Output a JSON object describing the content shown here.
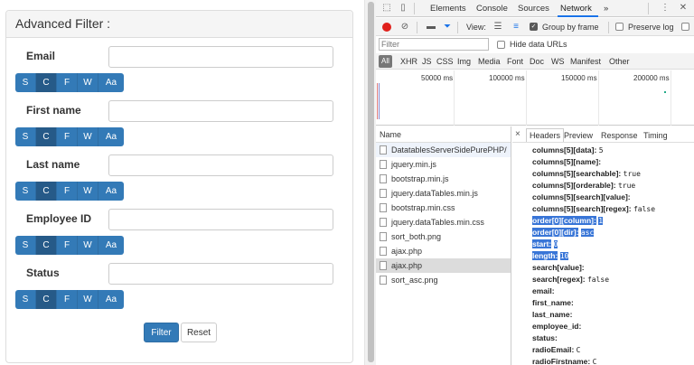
{
  "filter_panel": {
    "title": "Advanced Filter :",
    "modes": [
      "S",
      "C",
      "F",
      "W",
      "Aa"
    ],
    "fields": [
      {
        "label": "Email",
        "value": ""
      },
      {
        "label": "First name",
        "value": ""
      },
      {
        "label": "Last name",
        "value": ""
      },
      {
        "label": "Employee ID",
        "value": ""
      },
      {
        "label": "Status",
        "value": ""
      }
    ],
    "filter_button": "Filter",
    "reset_button": "Reset"
  },
  "devtools": {
    "tabs": [
      "Elements",
      "Console",
      "Sources",
      "Network"
    ],
    "active_tab": "Network",
    "more": "»",
    "toolbar": {
      "view_label": "View:",
      "group_by_frame": "Group by frame",
      "preserve_log": "Preserve log"
    },
    "filter_placeholder": "Filter",
    "hide_data_urls": "Hide data URLs",
    "types": [
      "All",
      "XHR",
      "JS",
      "CSS",
      "Img",
      "Media",
      "Font",
      "Doc",
      "WS",
      "Manifest",
      "Other"
    ],
    "timeline_labels": [
      "50000 ms",
      "100000 ms",
      "150000 ms",
      "200000 ms"
    ],
    "list_header": "Name",
    "requests": [
      "DatatablesServerSidePurePHP/",
      "jquery.min.js",
      "bootstrap.min.js",
      "jquery.dataTables.min.js",
      "bootstrap.min.css",
      "jquery.dataTables.min.css",
      "sort_both.png",
      "ajax.php",
      "ajax.php",
      "sort_asc.png"
    ],
    "detail_tabs": [
      "Headers",
      "Preview",
      "Response",
      "Timing"
    ],
    "close": "×",
    "params": [
      {
        "k": "columns[5][data]:",
        "v": "5",
        "hl": false
      },
      {
        "k": "columns[5][name]:",
        "v": "",
        "hl": false
      },
      {
        "k": "columns[5][searchable]:",
        "v": "true",
        "hl": false
      },
      {
        "k": "columns[5][orderable]:",
        "v": "true",
        "hl": false
      },
      {
        "k": "columns[5][search][value]:",
        "v": "",
        "hl": false
      },
      {
        "k": "columns[5][search][regex]:",
        "v": "false",
        "hl": false
      },
      {
        "k": "order[0][column]:",
        "v": "1",
        "hl": true
      },
      {
        "k": "order[0][dir]:",
        "v": "asc",
        "hl": true
      },
      {
        "k": "start:",
        "v": "0",
        "hl": true
      },
      {
        "k": "length:",
        "v": "10",
        "hl": true
      },
      {
        "k": "search[value]:",
        "v": "",
        "hl": false
      },
      {
        "k": "search[regex]:",
        "v": "false",
        "hl": false
      },
      {
        "k": "email:",
        "v": "",
        "hl": false
      },
      {
        "k": "first_name:",
        "v": "",
        "hl": false
      },
      {
        "k": "last_name:",
        "v": "",
        "hl": false
      },
      {
        "k": "employee_id:",
        "v": "",
        "hl": false
      },
      {
        "k": "status:",
        "v": "",
        "hl": false
      },
      {
        "k": "radioEmail:",
        "v": "C",
        "hl": false
      },
      {
        "k": "radioFirstname:",
        "v": "C",
        "hl": false
      }
    ]
  }
}
